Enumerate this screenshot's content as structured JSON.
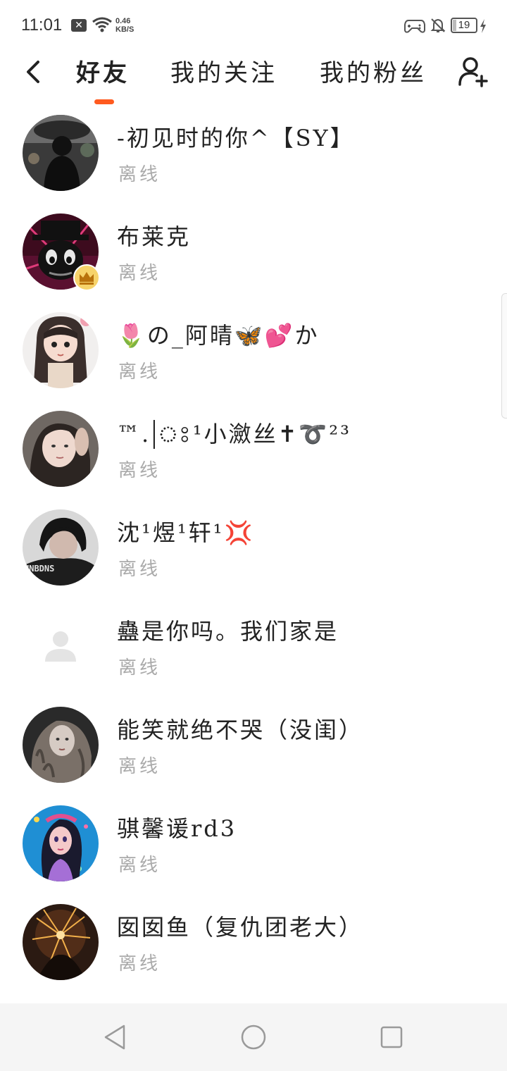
{
  "status_bar": {
    "time": "11:01",
    "network_speed_value": "0.46",
    "network_speed_unit": "KB/S",
    "battery_level": "19",
    "icons": [
      "notification-x-icon",
      "wifi-icon",
      "game-controller-icon",
      "bell-muted-icon",
      "battery-icon",
      "charging-bolt-icon"
    ]
  },
  "nav": {
    "tabs": [
      {
        "label": "好友",
        "active": true
      },
      {
        "label": "我的关注",
        "active": false
      },
      {
        "label": "我的粉丝",
        "active": false
      }
    ],
    "accent_color": "#ff5a1f",
    "icons": [
      "back-arrow-icon",
      "add-friend-icon"
    ]
  },
  "friends": [
    {
      "name": "-初见时的你^【SY】",
      "status": "离线",
      "avatar": "dark-photo-avatar"
    },
    {
      "name": "布莱克",
      "status": "离线",
      "avatar": "black-hat-character-avatar",
      "badge": "crown-icon"
    },
    {
      "name": "🌷の_阿晴🦋💕か",
      "status": "离线",
      "avatar": "doll-girl-avatar"
    },
    {
      "name": "™.|ঃ¹小瀲丝✝➰²³",
      "status": "离线",
      "avatar": "girl-selfie-avatar"
    },
    {
      "name": "沈¹煜¹轩¹💢",
      "status": "离线",
      "avatar": "boy-unbdns-shirt-avatar"
    },
    {
      "name": "蠱是你吗。我们家是",
      "status": "离线",
      "avatar": "default-person-avatar"
    },
    {
      "name": "能笑就绝不哭（没闺）",
      "status": "离线",
      "avatar": "curly-hair-girl-avatar"
    },
    {
      "name": "骐馨谖rd3",
      "status": "离线",
      "avatar": "anime-girl-blue-avatar"
    },
    {
      "name": "囡囡鱼（复仇团老大）",
      "status": "离线",
      "avatar": "fireworks-avatar"
    }
  ],
  "system_nav": {
    "icons": [
      "nav-back-icon",
      "nav-home-icon",
      "nav-recent-icon"
    ]
  }
}
